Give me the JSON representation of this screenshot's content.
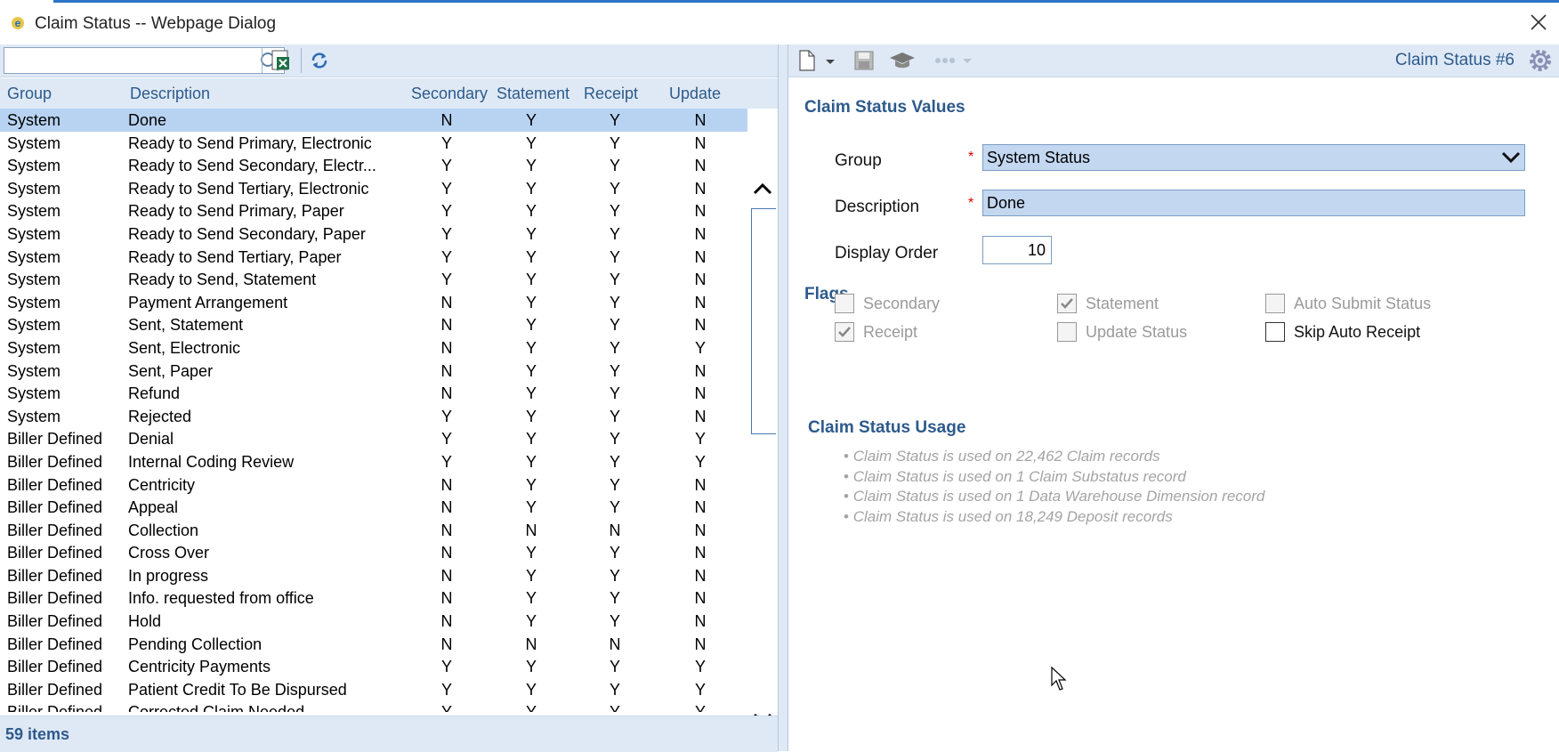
{
  "window": {
    "title": "Claim Status -- Webpage Dialog"
  },
  "left": {
    "search": {
      "value": "",
      "placeholder": ""
    },
    "columns": {
      "group": "Group",
      "description": "Description",
      "secondary": "Secondary",
      "statement": "Statement",
      "receipt": "Receipt",
      "update": "Update"
    },
    "rows": [
      {
        "group": "System",
        "description": "Done",
        "secondary": "N",
        "statement": "Y",
        "receipt": "Y",
        "update": "N"
      },
      {
        "group": "System",
        "description": "Ready to Send Primary, Electronic",
        "secondary": "Y",
        "statement": "Y",
        "receipt": "Y",
        "update": "N"
      },
      {
        "group": "System",
        "description": "Ready to Send Secondary, Electr...",
        "secondary": "Y",
        "statement": "Y",
        "receipt": "Y",
        "update": "N"
      },
      {
        "group": "System",
        "description": "Ready to Send Tertiary, Electronic",
        "secondary": "Y",
        "statement": "Y",
        "receipt": "Y",
        "update": "N"
      },
      {
        "group": "System",
        "description": "Ready to Send Primary, Paper",
        "secondary": "Y",
        "statement": "Y",
        "receipt": "Y",
        "update": "N"
      },
      {
        "group": "System",
        "description": "Ready to Send Secondary, Paper",
        "secondary": "Y",
        "statement": "Y",
        "receipt": "Y",
        "update": "N"
      },
      {
        "group": "System",
        "description": "Ready to Send Tertiary, Paper",
        "secondary": "Y",
        "statement": "Y",
        "receipt": "Y",
        "update": "N"
      },
      {
        "group": "System",
        "description": "Ready to Send, Statement",
        "secondary": "Y",
        "statement": "Y",
        "receipt": "Y",
        "update": "N"
      },
      {
        "group": "System",
        "description": "Payment Arrangement",
        "secondary": "N",
        "statement": "Y",
        "receipt": "Y",
        "update": "N"
      },
      {
        "group": "System",
        "description": "Sent, Statement",
        "secondary": "N",
        "statement": "Y",
        "receipt": "Y",
        "update": "N"
      },
      {
        "group": "System",
        "description": "Sent, Electronic",
        "secondary": "N",
        "statement": "Y",
        "receipt": "Y",
        "update": "Y"
      },
      {
        "group": "System",
        "description": "Sent, Paper",
        "secondary": "N",
        "statement": "Y",
        "receipt": "Y",
        "update": "N"
      },
      {
        "group": "System",
        "description": "Refund",
        "secondary": "N",
        "statement": "Y",
        "receipt": "Y",
        "update": "N"
      },
      {
        "group": "System",
        "description": "Rejected",
        "secondary": "Y",
        "statement": "Y",
        "receipt": "Y",
        "update": "N"
      },
      {
        "group": "Biller Defined",
        "description": "Denial",
        "secondary": "Y",
        "statement": "Y",
        "receipt": "Y",
        "update": "Y"
      },
      {
        "group": "Biller Defined",
        "description": "Internal Coding Review",
        "secondary": "Y",
        "statement": "Y",
        "receipt": "Y",
        "update": "Y"
      },
      {
        "group": "Biller Defined",
        "description": "Centricity",
        "secondary": "N",
        "statement": "Y",
        "receipt": "Y",
        "update": "N"
      },
      {
        "group": "Biller Defined",
        "description": "Appeal",
        "secondary": "N",
        "statement": "Y",
        "receipt": "Y",
        "update": "N"
      },
      {
        "group": "Biller Defined",
        "description": "Collection",
        "secondary": "N",
        "statement": "N",
        "receipt": "N",
        "update": "N"
      },
      {
        "group": "Biller Defined",
        "description": "Cross Over",
        "secondary": "N",
        "statement": "Y",
        "receipt": "Y",
        "update": "N"
      },
      {
        "group": "Biller Defined",
        "description": "In progress",
        "secondary": "N",
        "statement": "Y",
        "receipt": "Y",
        "update": "N"
      },
      {
        "group": "Biller Defined",
        "description": "Info. requested from office",
        "secondary": "N",
        "statement": "Y",
        "receipt": "Y",
        "update": "N"
      },
      {
        "group": "Biller Defined",
        "description": "Hold",
        "secondary": "N",
        "statement": "Y",
        "receipt": "Y",
        "update": "N"
      },
      {
        "group": "Biller Defined",
        "description": "Pending Collection",
        "secondary": "N",
        "statement": "N",
        "receipt": "N",
        "update": "N"
      },
      {
        "group": "Biller Defined",
        "description": "Centricity Payments",
        "secondary": "Y",
        "statement": "Y",
        "receipt": "Y",
        "update": "Y"
      },
      {
        "group": "Biller Defined",
        "description": "Patient Credit To Be Dispursed",
        "secondary": "Y",
        "statement": "Y",
        "receipt": "Y",
        "update": "Y"
      },
      {
        "group": "Biller Defined",
        "description": "Corrected Claim Needed",
        "secondary": "Y",
        "statement": "Y",
        "receipt": "Y",
        "update": "Y"
      }
    ],
    "footer": "59 items"
  },
  "right": {
    "record_label": "Claim Status #6",
    "values_header": "Claim Status Values",
    "group_label": "Group",
    "group_value": "System Status",
    "description_label": "Description",
    "description_value": "Done",
    "display_order_label": "Display Order",
    "display_order_value": "10",
    "flags_header": "Flags",
    "flags": [
      {
        "label": "Secondary",
        "checked": false,
        "enabled": false
      },
      {
        "label": "Statement",
        "checked": true,
        "enabled": false
      },
      {
        "label": "Auto Submit Status",
        "checked": false,
        "enabled": false
      },
      {
        "label": "Receipt",
        "checked": true,
        "enabled": false
      },
      {
        "label": "Update Status",
        "checked": false,
        "enabled": false
      },
      {
        "label": "Skip Auto Receipt",
        "checked": false,
        "enabled": true
      }
    ],
    "usage_header": "Claim Status Usage",
    "usage": [
      "Claim Status is used on 22,462 Claim records",
      "Claim Status is used on 1 Claim Substatus record",
      "Claim Status is used on 1 Data Warehouse Dimension record",
      "Claim Status is used on 18,249 Deposit records"
    ]
  },
  "icons": [
    "ie-icon",
    "close-icon",
    "search-icon",
    "export-excel-icon",
    "refresh-icon",
    "new-document-icon",
    "dropdown-arrow-icon",
    "save-icon",
    "graduation-cap-icon",
    "more-icon",
    "gear-icon",
    "chevron-up-icon",
    "chevron-down-icon",
    "check-icon",
    "mouse-cursor-icon"
  ],
  "colors": {
    "accent": "#2d5a8c",
    "selection": "#b8d3f2",
    "toolbar": "#dfe9f5",
    "field": "#c3d7f1",
    "required": "#dd0000"
  }
}
